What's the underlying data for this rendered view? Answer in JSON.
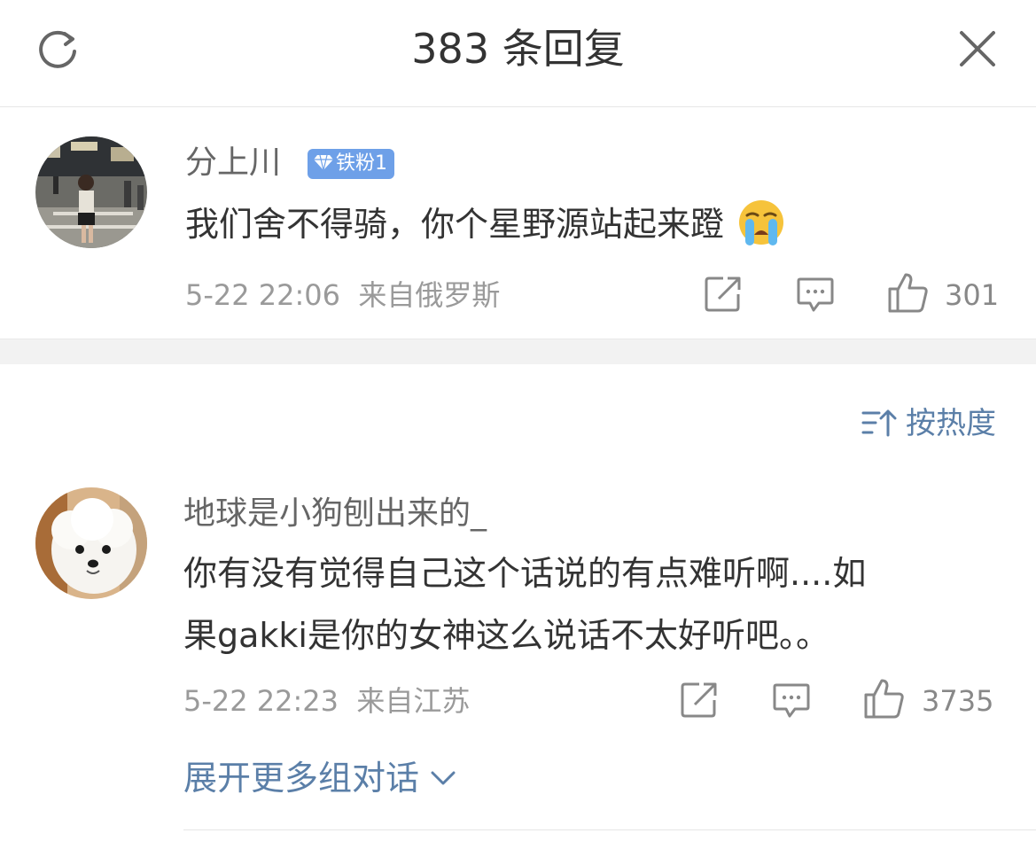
{
  "header": {
    "title": "383 条回复",
    "icons": {
      "refresh": "refresh-icon",
      "close": "close-icon"
    }
  },
  "root_comment": {
    "username": "分上川",
    "badge": "铁粉1",
    "text": "我们舍不得骑，你个星野源站起来蹬",
    "emoji": "crying-face-emoji",
    "time": "5-22 22:06",
    "source": "来自俄罗斯",
    "likes": "301"
  },
  "sort": {
    "label": "按热度"
  },
  "reply": {
    "username": "地球是小狗刨出来的_",
    "text_line1": "你有没有觉得自己这个话说的有点难听啊....如",
    "text_line2": "果gakki是你的女神这么说话不太好听吧。。",
    "time": "5-22 22:23",
    "source": "来自江苏",
    "likes": "3735"
  },
  "expand": {
    "label": "展开更多组对话"
  },
  "colors": {
    "link": "#5b7fa8",
    "badge": "#6ea0e8",
    "meta": "#9a9a9a"
  }
}
